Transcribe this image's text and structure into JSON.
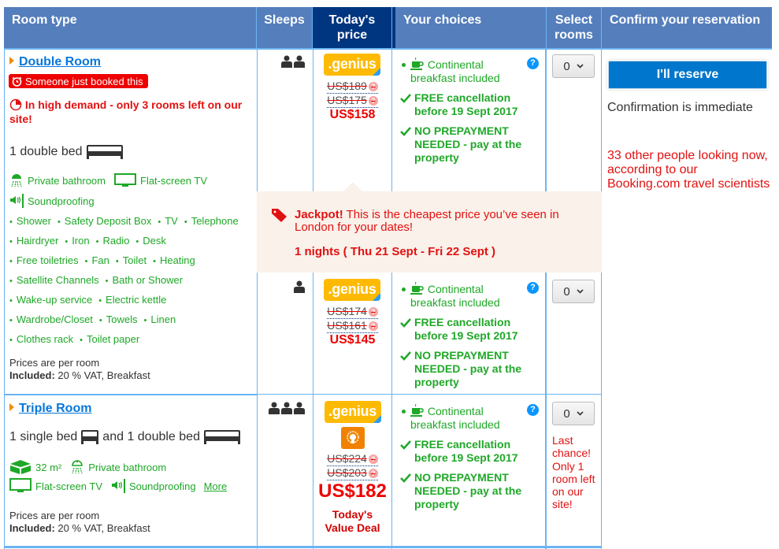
{
  "header": {
    "room_type": "Room type",
    "sleeps": "Sleeps",
    "todays_price": "Today's price",
    "your_choices": "Your choices",
    "select_rooms": "Select rooms",
    "confirm": "Confirm your reservation"
  },
  "colors": {
    "header_bg": "#557ebc",
    "price_header_bg": "#003580",
    "grid_line": "#6bb4f2",
    "green": "#1fa828",
    "red": "#e21111",
    "link_blue": "#0777da",
    "genius_yellow": "#feba02",
    "reserve_blue": "#0077cc",
    "jackpot_bg": "#f9f1ea"
  },
  "double_room": {
    "name": "Double Room",
    "booked_badge": "Someone just booked this",
    "demand": "In high demand - only 3 rooms left on our site!",
    "beds": "1 double bed",
    "highlight_facilities": [
      {
        "icon": "shower-icon",
        "label": "Private bathroom"
      },
      {
        "icon": "tv-icon",
        "label": "Flat-screen TV"
      },
      {
        "icon": "soundproofing-icon",
        "label": "Soundproofing"
      }
    ],
    "facilities": [
      [
        "Shower",
        "Safety Deposit Box",
        "TV",
        "Telephone"
      ],
      [
        "Hairdryer",
        "Iron",
        "Radio",
        "Desk"
      ],
      [
        "Free toiletries",
        "Fan",
        "Toilet",
        "Heating"
      ],
      [
        "Satellite Channels",
        "Bath or Shower"
      ],
      [
        "Wake-up service",
        "Electric kettle"
      ],
      [
        "Wardrobe/Closet",
        "Towels",
        "Linen"
      ],
      [
        "Clothes rack",
        "Toilet paper"
      ]
    ],
    "prices_note": "Prices are per room",
    "included_label": "Included:",
    "included_value": " 20 % VAT, Breakfast",
    "options": [
      {
        "sleeps": 2,
        "genius": ".genius",
        "old_prices": [
          "US$189",
          "US$175"
        ],
        "price": "US$158",
        "choices": {
          "breakfast": "Continental breakfast included",
          "cancellation": "FREE cancellation before 19 Sept 2017",
          "prepayment": "NO PREPAYMENT NEEDED - pay at the property"
        },
        "selected_rooms": "0"
      },
      {
        "sleeps": 1,
        "genius": ".genius",
        "old_prices": [
          "US$174",
          "US$161"
        ],
        "price": "US$145",
        "choices": {
          "breakfast": "Continental breakfast included",
          "cancellation": "FREE cancellation before 19 Sept 2017",
          "prepayment": "NO PREPAYMENT NEEDED - pay at the property"
        },
        "selected_rooms": "0"
      }
    ]
  },
  "jackpot": {
    "title": "Jackpot!",
    "text": " This is the cheapest price you’ve seen in London for your dates!",
    "dates": "1 nights ( Thu 21 Sept - Fri 22 Sept )"
  },
  "triple_room": {
    "name": "Triple Room",
    "beds_part1": "1 single bed",
    "beds_and": "and 1 double bed",
    "size": "32 m²",
    "facilities": [
      {
        "icon": "shower-icon",
        "label": "Private bathroom"
      },
      {
        "icon": "tv-icon",
        "label": "Flat-screen TV"
      },
      {
        "icon": "soundproofing-icon",
        "label": "Soundproofing"
      }
    ],
    "more_link": "More",
    "prices_note": "Prices are per room",
    "included_label": "Included:",
    "included_value": " 20 % VAT, Breakfast",
    "option": {
      "sleeps": 3,
      "genius": ".genius",
      "old_prices": [
        "US$224",
        "US$203"
      ],
      "price": "US$182",
      "deal_label": "Today's Value Deal",
      "choices": {
        "breakfast": "Continental breakfast included",
        "cancellation": "FREE cancellation before 19 Sept 2017",
        "prepayment": "NO PREPAYMENT NEEDED - pay at the property"
      },
      "selected_rooms": "0",
      "last_chance": "Last chance! Only 1 room left on our site!"
    }
  },
  "reservation": {
    "button": "I'll reserve",
    "confirmation": "Confirmation is immediate",
    "looking": "33 other people looking now, according to our Booking.com travel scientists"
  }
}
